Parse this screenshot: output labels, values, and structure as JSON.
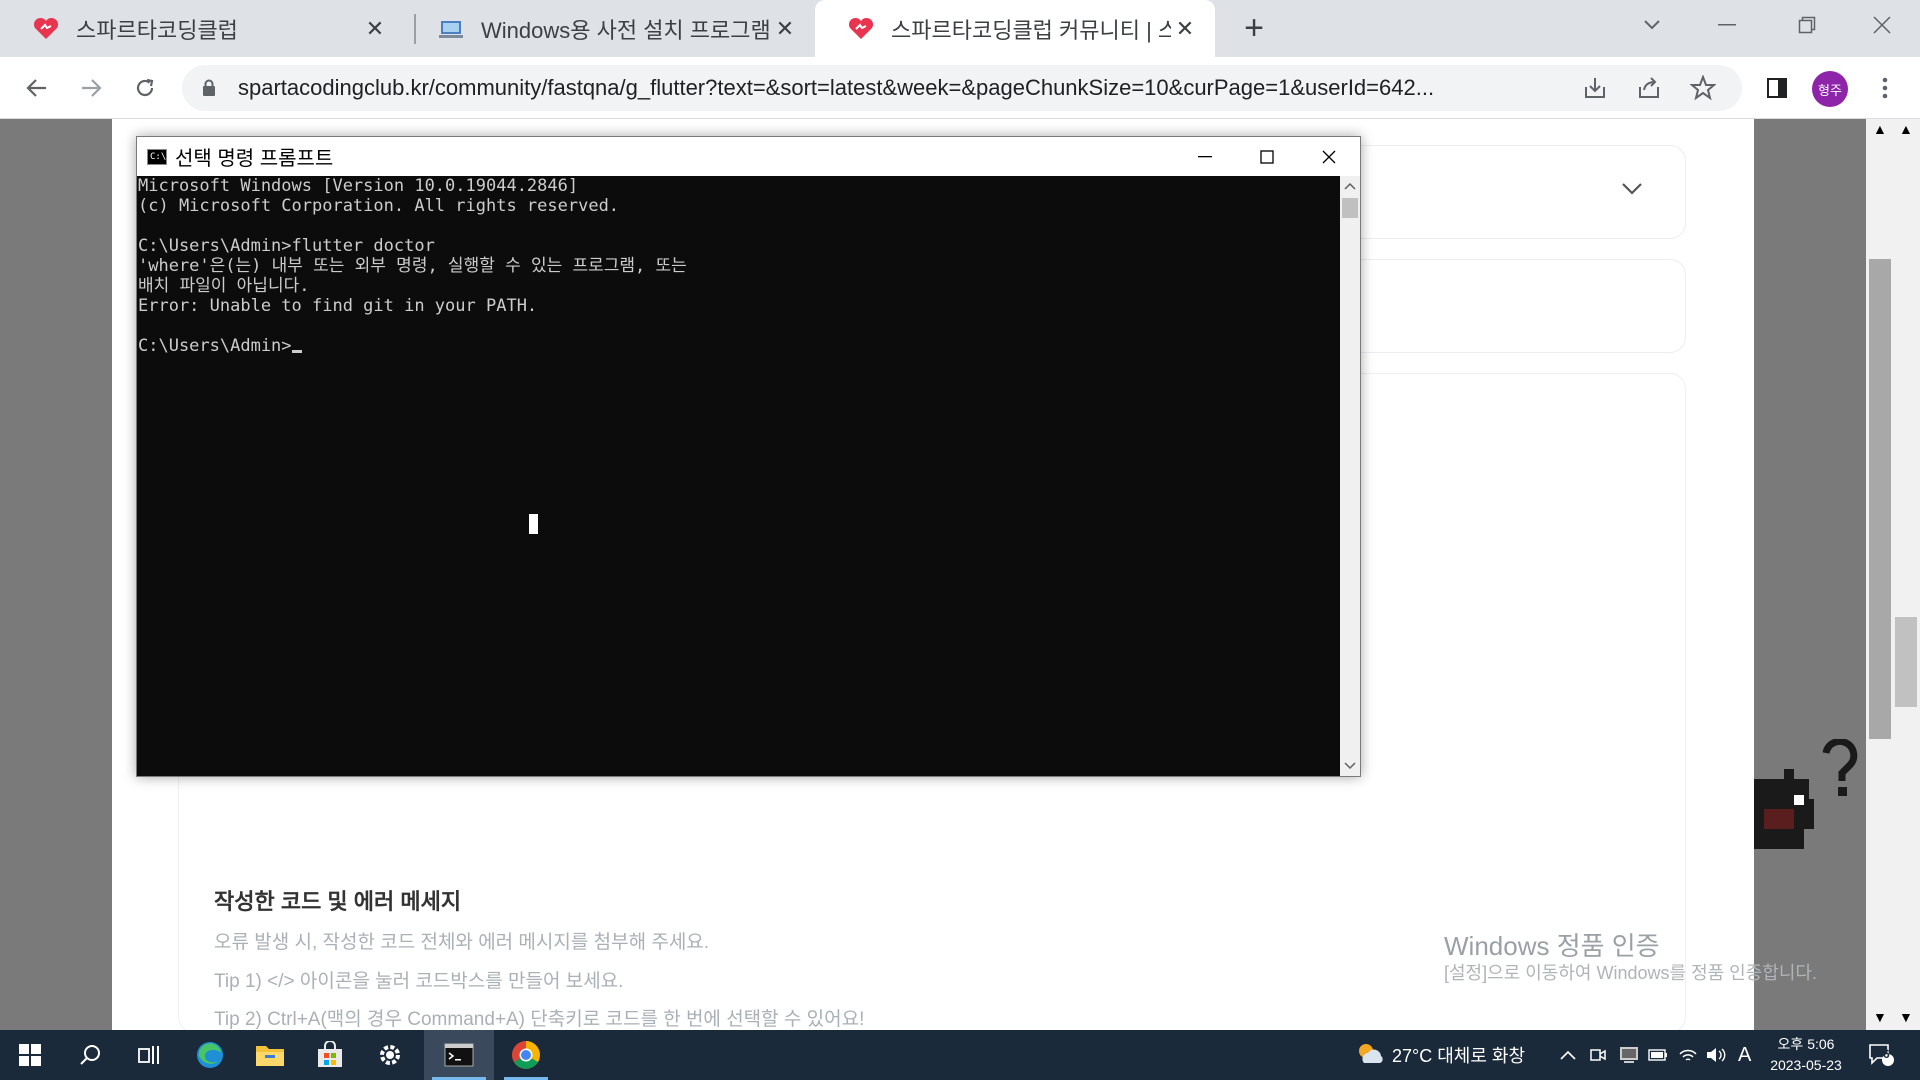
{
  "browser": {
    "tabs": [
      {
        "title": "스파르타코딩클럽",
        "favicon": "sparta-heart-icon",
        "active": false
      },
      {
        "title": "Windows용 사전 설치 프로그램",
        "favicon": "laptop-icon",
        "active": false
      },
      {
        "title": "스파르타코딩클럽 커뮤니티 | 스",
        "favicon": "sparta-heart-icon",
        "active": true
      }
    ],
    "url": "spartacodingclub.kr/community/fastqna/g_flutter?text=&sort=latest&week=&pageChunkSize=10&curPage=1&userId=642...",
    "profile_initials": "형주",
    "accent": "#dee1e6"
  },
  "page": {
    "section_title": "작성한 코드 및 에러 메세지",
    "lines": [
      "오류 발생 시, 작성한 코드 전체와 에러 메시지를 첨부해 주세요.",
      "Tip 1) </> 아이콘을 눌러 코드박스를 만들어 보세요.",
      "Tip 2) Ctrl+A(맥의 경우 Command+A) 단축키로 코드를 한 번에 선택할 수 있어요!"
    ],
    "watermark_title": "Windows 정품 인증",
    "watermark_sub": "[설정]으로 이동하여 Windows를 정품 인증합니다."
  },
  "console": {
    "title": "선택 명령 프롬프트",
    "icon_text": "C:\\",
    "lines": [
      "Microsoft Windows [Version 10.0.19044.2846]",
      "(c) Microsoft Corporation. All rights reserved.",
      "",
      "C:\\Users\\Admin>flutter doctor",
      "'where'은(는) 내부 또는 외부 명령, 실행할 수 있는 프로그램, 또는",
      "배치 파일이 아닙니다.",
      "Error: Unable to find git in your PATH.",
      ""
    ],
    "prompt": "C:\\Users\\Admin>"
  },
  "taskbar": {
    "weather": "27°C 대체로 화창",
    "ime": "A",
    "time": "오후 5:06",
    "date": "2023-05-23",
    "notifications": "6"
  }
}
